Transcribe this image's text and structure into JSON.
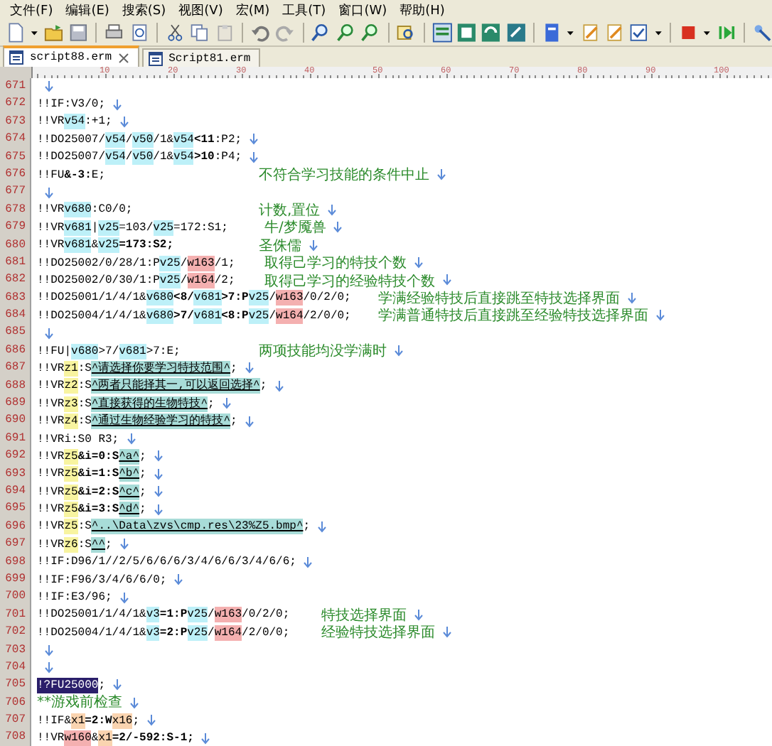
{
  "menu": [
    "文件(F)",
    "编辑(E)",
    "搜索(S)",
    "视图(V)",
    "宏(M)",
    "工具(T)",
    "窗口(W)",
    "帮助(H)"
  ],
  "tabs": [
    {
      "label": "script88.erm",
      "selected": true
    },
    {
      "label": "Script81.erm",
      "selected": false
    }
  ],
  "ruler": [
    "10",
    "20",
    "30",
    "40",
    "50",
    "60",
    "70",
    "80",
    "90",
    "100"
  ],
  "lines": [
    {
      "number": "671"
    },
    {
      "number": "672",
      "code": [
        {
          "text": "!!IF:V3/0;",
          "kind": "plain"
        }
      ]
    },
    {
      "number": "673",
      "code": [
        {
          "text": "!!VR",
          "kind": "plain"
        },
        {
          "text": "v54",
          "kind": "var"
        },
        {
          "text": ":+1;",
          "kind": "plain"
        }
      ]
    },
    {
      "number": "674",
      "code": [
        {
          "text": "!!DO25007/",
          "kind": "plain"
        },
        {
          "text": "v54",
          "kind": "var"
        },
        {
          "text": "/",
          "kind": "plain"
        },
        {
          "text": "v50",
          "kind": "var"
        },
        {
          "text": "/1&",
          "kind": "plain"
        },
        {
          "text": "v54",
          "kind": "var"
        },
        {
          "text": "<11",
          "kind": "bold"
        },
        {
          "text": ":P2;",
          "kind": "plain"
        }
      ]
    },
    {
      "number": "675",
      "code": [
        {
          "text": "!!DO25007/",
          "kind": "plain"
        },
        {
          "text": "v54",
          "kind": "var"
        },
        {
          "text": "/",
          "kind": "plain"
        },
        {
          "text": "v50",
          "kind": "var"
        },
        {
          "text": "/1&",
          "kind": "plain"
        },
        {
          "text": "v54",
          "kind": "var"
        },
        {
          "text": ">10",
          "kind": "bold"
        },
        {
          "text": ":P4;",
          "kind": "plain"
        }
      ]
    },
    {
      "number": "676",
      "code": [
        {
          "text": "!!FU",
          "kind": "plain"
        },
        {
          "text": "&-3:",
          "kind": "bold"
        },
        {
          "text": "E;",
          "kind": "plain"
        }
      ],
      "comment": "不符合学习技能的条件中止"
    },
    {
      "number": "677"
    },
    {
      "number": "678",
      "code": [
        {
          "text": "!!VR",
          "kind": "plain"
        },
        {
          "text": "v680",
          "kind": "var"
        },
        {
          "text": ":C0/0;",
          "kind": "plain"
        }
      ],
      "comment": "计数,置位"
    },
    {
      "number": "679",
      "code": [
        {
          "text": "!!VR",
          "kind": "plain"
        },
        {
          "text": "v681",
          "kind": "var"
        },
        {
          "text": "|",
          "kind": "plain"
        },
        {
          "text": "v25",
          "kind": "var"
        },
        {
          "text": "=103/",
          "kind": "plain"
        },
        {
          "text": "v25",
          "kind": "var"
        },
        {
          "text": "=172:S1;",
          "kind": "plain"
        }
      ],
      "comment": "牛/梦魇兽"
    },
    {
      "number": "680",
      "code": [
        {
          "text": "!!VR",
          "kind": "plain"
        },
        {
          "text": "v681",
          "kind": "var"
        },
        {
          "text": "&",
          "kind": "plain"
        },
        {
          "text": "v25",
          "kind": "var"
        },
        {
          "text": "=173:S2;",
          "kind": "bold"
        }
      ],
      "comment": "圣侏儒"
    },
    {
      "number": "681",
      "code": [
        {
          "text": "!!DO25002/0/28/1:P",
          "kind": "plain"
        },
        {
          "text": "v25",
          "kind": "var"
        },
        {
          "text": "/",
          "kind": "plain"
        },
        {
          "text": "w163",
          "kind": "flag"
        },
        {
          "text": "/1;",
          "kind": "plain"
        }
      ],
      "comment": "取得己学习的特技个数"
    },
    {
      "number": "682",
      "code": [
        {
          "text": "!!DO25002/0/30/1:P",
          "kind": "plain"
        },
        {
          "text": "v25",
          "kind": "var"
        },
        {
          "text": "/",
          "kind": "plain"
        },
        {
          "text": "w164",
          "kind": "flag"
        },
        {
          "text": "/2;",
          "kind": "plain"
        }
      ],
      "comment": "取得己学习的经验特技个数"
    },
    {
      "number": "683",
      "code": [
        {
          "text": "!!DO25001/1/4/1&",
          "kind": "plain"
        },
        {
          "text": "v680",
          "kind": "var"
        },
        {
          "text": "<8/",
          "kind": "bold"
        },
        {
          "text": "v681",
          "kind": "var"
        },
        {
          "text": ">7:P",
          "kind": "bold"
        },
        {
          "text": "v25",
          "kind": "var"
        },
        {
          "text": "/",
          "kind": "plain"
        },
        {
          "text": "w163",
          "kind": "flag"
        },
        {
          "text": "/0/2/0;",
          "kind": "plain"
        }
      ],
      "comment": "学满经验特技后直接跳至特技选择界面"
    },
    {
      "number": "684",
      "code": [
        {
          "text": "!!DO25004/1/4/1&",
          "kind": "plain"
        },
        {
          "text": "v680",
          "kind": "var"
        },
        {
          "text": ">7/",
          "kind": "bold"
        },
        {
          "text": "v681",
          "kind": "var"
        },
        {
          "text": "<8:P",
          "kind": "bold"
        },
        {
          "text": "v25",
          "kind": "var"
        },
        {
          "text": "/",
          "kind": "plain"
        },
        {
          "text": "w164",
          "kind": "flag"
        },
        {
          "text": "/2/0/0;",
          "kind": "plain"
        }
      ],
      "comment": "学满普通特技后直接跳至经验特技选择界面"
    },
    {
      "number": "685"
    },
    {
      "number": "686",
      "code": [
        {
          "text": "!!FU|",
          "kind": "plain"
        },
        {
          "text": "v680",
          "kind": "var"
        },
        {
          "text": ">7/",
          "kind": "plain"
        },
        {
          "text": "v681",
          "kind": "var"
        },
        {
          "text": ">7:E;",
          "kind": "plain"
        }
      ],
      "comment": "两项技能均没学满时"
    },
    {
      "number": "687",
      "code": [
        {
          "text": "!!VR",
          "kind": "plain"
        },
        {
          "text": "z1",
          "kind": "zvar"
        },
        {
          "text": ":S",
          "kind": "plain"
        },
        {
          "text": "^请选择你要学习特技范围^",
          "kind": "string"
        },
        {
          "text": ";",
          "kind": "plain"
        }
      ]
    },
    {
      "number": "688",
      "code": [
        {
          "text": "!!VR",
          "kind": "plain"
        },
        {
          "text": "z2",
          "kind": "zvar"
        },
        {
          "text": ":S",
          "kind": "plain"
        },
        {
          "text": "^两者只能择其一,可以返回选择^",
          "kind": "string"
        },
        {
          "text": ";",
          "kind": "plain"
        }
      ]
    },
    {
      "number": "689",
      "code": [
        {
          "text": "!!VR",
          "kind": "plain"
        },
        {
          "text": "z3",
          "kind": "zvar"
        },
        {
          "text": ":S",
          "kind": "plain"
        },
        {
          "text": "^直接获得的生物特技^",
          "kind": "string"
        },
        {
          "text": ";",
          "kind": "plain"
        }
      ]
    },
    {
      "number": "690",
      "code": [
        {
          "text": "!!VR",
          "kind": "plain"
        },
        {
          "text": "z4",
          "kind": "zvar"
        },
        {
          "text": ":S",
          "kind": "plain"
        },
        {
          "text": "^通过生物经验学习的特技^",
          "kind": "string"
        },
        {
          "text": ";",
          "kind": "plain"
        }
      ]
    },
    {
      "number": "691",
      "code": [
        {
          "text": "!!VRi:S0 R3;",
          "kind": "plain"
        }
      ]
    },
    {
      "number": "692",
      "code": [
        {
          "text": "!!VR",
          "kind": "plain"
        },
        {
          "text": "z5",
          "kind": "zvar"
        },
        {
          "text": "&i=0:S",
          "kind": "bold"
        },
        {
          "text": "^a^",
          "kind": "string"
        },
        {
          "text": ";",
          "kind": "plain"
        }
      ]
    },
    {
      "number": "693",
      "code": [
        {
          "text": "!!VR",
          "kind": "plain"
        },
        {
          "text": "z5",
          "kind": "zvar"
        },
        {
          "text": "&i=1:S",
          "kind": "bold"
        },
        {
          "text": "^b^",
          "kind": "string"
        },
        {
          "text": ";",
          "kind": "plain"
        }
      ]
    },
    {
      "number": "694",
      "code": [
        {
          "text": "!!VR",
          "kind": "plain"
        },
        {
          "text": "z5",
          "kind": "zvar"
        },
        {
          "text": "&i=2:S",
          "kind": "bold"
        },
        {
          "text": "^c^",
          "kind": "string"
        },
        {
          "text": ";",
          "kind": "plain"
        }
      ]
    },
    {
      "number": "695",
      "code": [
        {
          "text": "!!VR",
          "kind": "plain"
        },
        {
          "text": "z5",
          "kind": "zvar"
        },
        {
          "text": "&i=3:S",
          "kind": "bold"
        },
        {
          "text": "^d^",
          "kind": "string"
        },
        {
          "text": ";",
          "kind": "plain"
        }
      ]
    },
    {
      "number": "696",
      "code": [
        {
          "text": "!!VR",
          "kind": "plain"
        },
        {
          "text": "z5",
          "kind": "zvar"
        },
        {
          "text": ":S",
          "kind": "plain"
        },
        {
          "text": "^..\\Data\\zvs\\cmp.res\\23%Z5.bmp^",
          "kind": "string"
        },
        {
          "text": ";",
          "kind": "plain"
        }
      ]
    },
    {
      "number": "697",
      "code": [
        {
          "text": "!!VR",
          "kind": "plain"
        },
        {
          "text": "z6",
          "kind": "zvar"
        },
        {
          "text": ":S",
          "kind": "plain"
        },
        {
          "text": "^^",
          "kind": "string"
        },
        {
          "text": ";",
          "kind": "plain"
        }
      ]
    },
    {
      "number": "698",
      "code": [
        {
          "text": "!!IF:D96/1//2/5/6/6/6/3/4/6/6/3/4/6/6;",
          "kind": "plain"
        }
      ]
    },
    {
      "number": "699",
      "code": [
        {
          "text": "!!IF:F96/3/4/6/6/0;",
          "kind": "plain"
        }
      ]
    },
    {
      "number": "700",
      "code": [
        {
          "text": "!!IF:E3/96;",
          "kind": "plain"
        }
      ]
    },
    {
      "number": "701",
      "code": [
        {
          "text": "!!DO25001/1/4/1&",
          "kind": "plain"
        },
        {
          "text": "v3",
          "kind": "var"
        },
        {
          "text": "=1:P",
          "kind": "bold"
        },
        {
          "text": "v25",
          "kind": "var"
        },
        {
          "text": "/",
          "kind": "plain"
        },
        {
          "text": "w163",
          "kind": "flag"
        },
        {
          "text": "/0/2/0;",
          "kind": "plain"
        }
      ],
      "comment": "特技选择界面"
    },
    {
      "number": "702",
      "code": [
        {
          "text": "!!DO25004/1/4/1&",
          "kind": "plain"
        },
        {
          "text": "v3",
          "kind": "var"
        },
        {
          "text": "=2:P",
          "kind": "bold"
        },
        {
          "text": "v25",
          "kind": "var"
        },
        {
          "text": "/",
          "kind": "plain"
        },
        {
          "text": "w164",
          "kind": "flag"
        },
        {
          "text": "/2/0/0;",
          "kind": "plain"
        }
      ],
      "comment": "经验特技选择界面"
    },
    {
      "number": "703"
    },
    {
      "number": "704"
    },
    {
      "number": "705",
      "code": [
        {
          "text": "!?FU25000",
          "kind": "selected"
        },
        {
          "text": ";",
          "kind": "plain"
        }
      ]
    },
    {
      "number": "706",
      "code": [
        {
          "text": "**游戏前检查",
          "kind": "remark"
        }
      ]
    },
    {
      "number": "707",
      "code": [
        {
          "text": "!!IF&",
          "kind": "plain"
        },
        {
          "text": "x1",
          "kind": "xvar"
        },
        {
          "text": "=2:W",
          "kind": "bold"
        },
        {
          "text": "x16",
          "kind": "xvar"
        },
        {
          "text": ";",
          "kind": "plain"
        }
      ]
    },
    {
      "number": "708",
      "code": [
        {
          "text": "!!VR",
          "kind": "plain"
        },
        {
          "text": "w160",
          "kind": "flag"
        },
        {
          "text": "&",
          "kind": "plain"
        },
        {
          "text": "x1",
          "kind": "xvar"
        },
        {
          "text": "=2/-592:S-1;",
          "kind": "bold"
        }
      ]
    }
  ]
}
